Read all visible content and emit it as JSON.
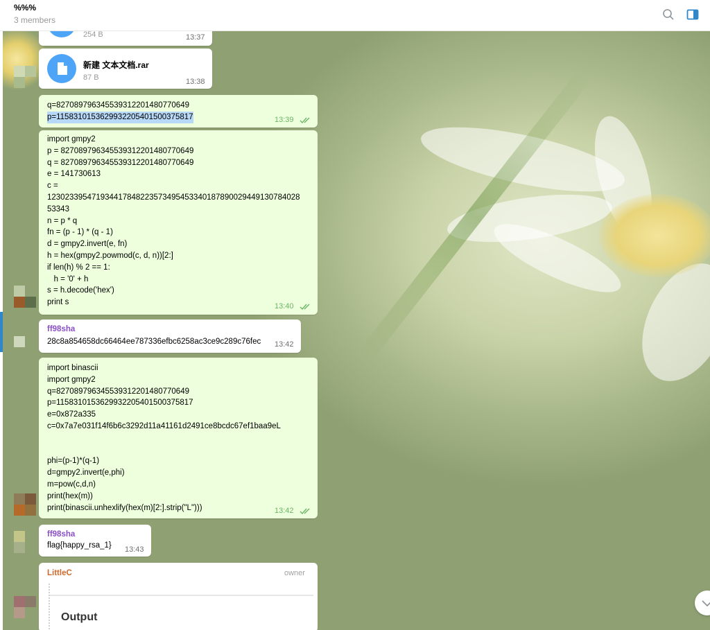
{
  "header": {
    "title": "%%%",
    "subtitle": "3 members",
    "search_icon": "search-icon",
    "panel_icon": "sidebar-panel-icon"
  },
  "messages": {
    "file1": {
      "size": "254 B",
      "time": "13:37"
    },
    "file2": {
      "name": "新建 文本文档.rar",
      "size": "87 B",
      "time": "13:38"
    },
    "msg_pq": {
      "line1": "q=82708979634553931220148077064​9",
      "line2": "p=115831015362993220540150037581​7",
      "time": "13:39"
    },
    "msg_code1": {
      "text": "import gmpy2\np = 827089796345539312201480770649\nq = 827089796345539312201480770649\ne = 141730613\nc =\n1230233954719344178482235734954533401878900294491307840​28\n53343\nn = p * q\nfn = (p - 1) * (q - 1)\nd = gmpy2.invert(e, fn)\nh = hex(gmpy2.powmod(c, d, n))[2:]\nif len(h) % 2 == 1:\n   h = '0' + h\ns = h.decode('hex')\nprint s",
      "time": "13:40"
    },
    "msg_sha": {
      "sender": "ff98sha",
      "text": "28c8a854658dc66464ee787336efbc6258ac3ce9c289c76fec",
      "time": "13:42"
    },
    "msg_code2": {
      "text": "import binascii\nimport gmpy2\nq=827089796345539312201480770649\np=1158310153629932205401500375817\ne=0x872a335\nc=0x7a7e031f14f6b6c3292d11a41161d2491ce8bcdc67ef1baa9eL\n\n\nphi=(p-1)*(q-1)\nd=gmpy2.invert(e,phi)\nm=pow(c,d,n)\nprint(hex(m))\nprint(binascii.unhexlify(hex(m)[2:].strip(\"L\")))",
      "time": "13:42"
    },
    "msg_flag": {
      "sender": "ff98sha",
      "text": "flag{happy_rsa_1}",
      "time": "13:43"
    },
    "msg_output": {
      "sender": "LittleC",
      "badge": "owner",
      "embed_title": "Output"
    }
  },
  "colors": {
    "accent": "#2f86c8",
    "outgoing_bubble": "#eeffde",
    "sender_violet": "#8a4fc7",
    "sender_orange": "#d1692c"
  }
}
